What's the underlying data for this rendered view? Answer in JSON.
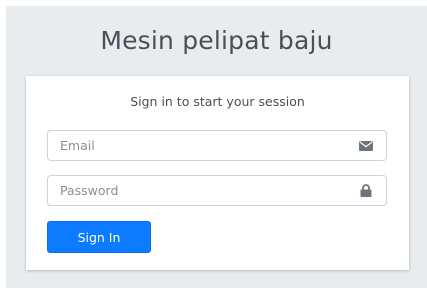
{
  "brand": {
    "title": "Mesin pelipat baju"
  },
  "login": {
    "message": "Sign in to start your session",
    "email": {
      "placeholder": "Email",
      "value": "",
      "icon": "envelope-icon"
    },
    "password": {
      "placeholder": "Password",
      "value": "",
      "icon": "lock-icon"
    },
    "signin_label": "Sign In"
  },
  "colors": {
    "page_background": "#e9ecef",
    "card_background": "#ffffff",
    "primary_button": "#0d7bff",
    "icon": "#6c757d"
  }
}
